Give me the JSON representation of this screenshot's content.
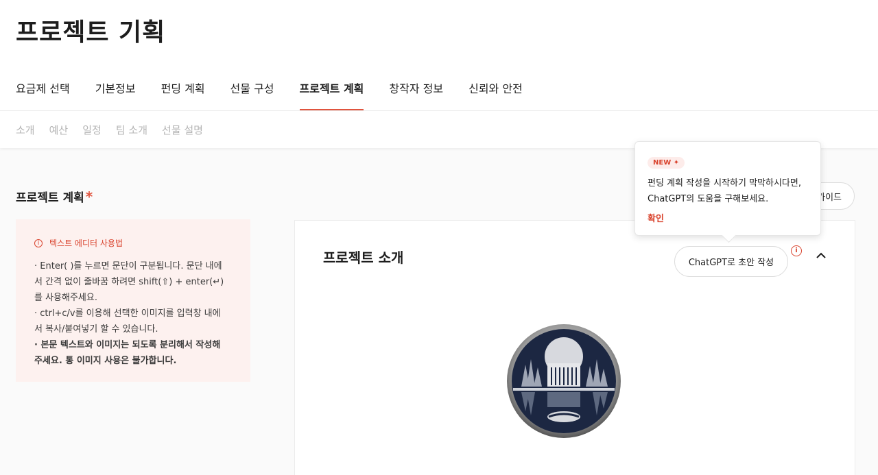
{
  "header": {
    "title": "프로젝트 기획"
  },
  "main_tabs": [
    {
      "label": "요금제 선택",
      "active": false
    },
    {
      "label": "기본정보",
      "active": false
    },
    {
      "label": "펀딩 계획",
      "active": false
    },
    {
      "label": "선물 구성",
      "active": false
    },
    {
      "label": "프로젝트 계획",
      "active": true
    },
    {
      "label": "창작자 정보",
      "active": false
    },
    {
      "label": "신뢰와 안전",
      "active": false
    }
  ],
  "sub_tabs": [
    "소개",
    "예산",
    "일정",
    "팀 소개",
    "선물 설명"
  ],
  "section": {
    "title": "프로젝트 계획",
    "required_mark": "*"
  },
  "guide": {
    "heading": "텍스트 에디터 사용법",
    "lines": [
      "· Enter( )를 누르면 문단이 구분됩니다. 문단 내에",
      "서 간격 없이 줄바꿈 하려면 shift(⇧) + enter(↵)",
      "를 사용해주세요.",
      "· ctrl+c/v를 이용해 선택한 이미지를 입력창 내에",
      "서 복사/붙여넣기 할 수 있습니다.",
      "· 본문 텍스트와 이미지는 되도록 분리해서 작성해",
      "주세요. 통 이미지 사용은 불가합니다."
    ]
  },
  "editor": {
    "title": "프로젝트 소개",
    "gpt_button": "ChatGPT로 초안 작성",
    "info_icon": "info-icon",
    "collapse_icon": "chevron-up-icon"
  },
  "guide_pill": {
    "label": "가이드"
  },
  "tooltip": {
    "badge": "NEW ✦",
    "line1": "펀딩 계획 작성을 시작하기 막막하시다면,",
    "line2": "ChatGPT의 도움을 구해보세요.",
    "confirm": "확인"
  },
  "colors": {
    "accent": "#e0543e",
    "guide_bg": "#fdf1ef"
  }
}
